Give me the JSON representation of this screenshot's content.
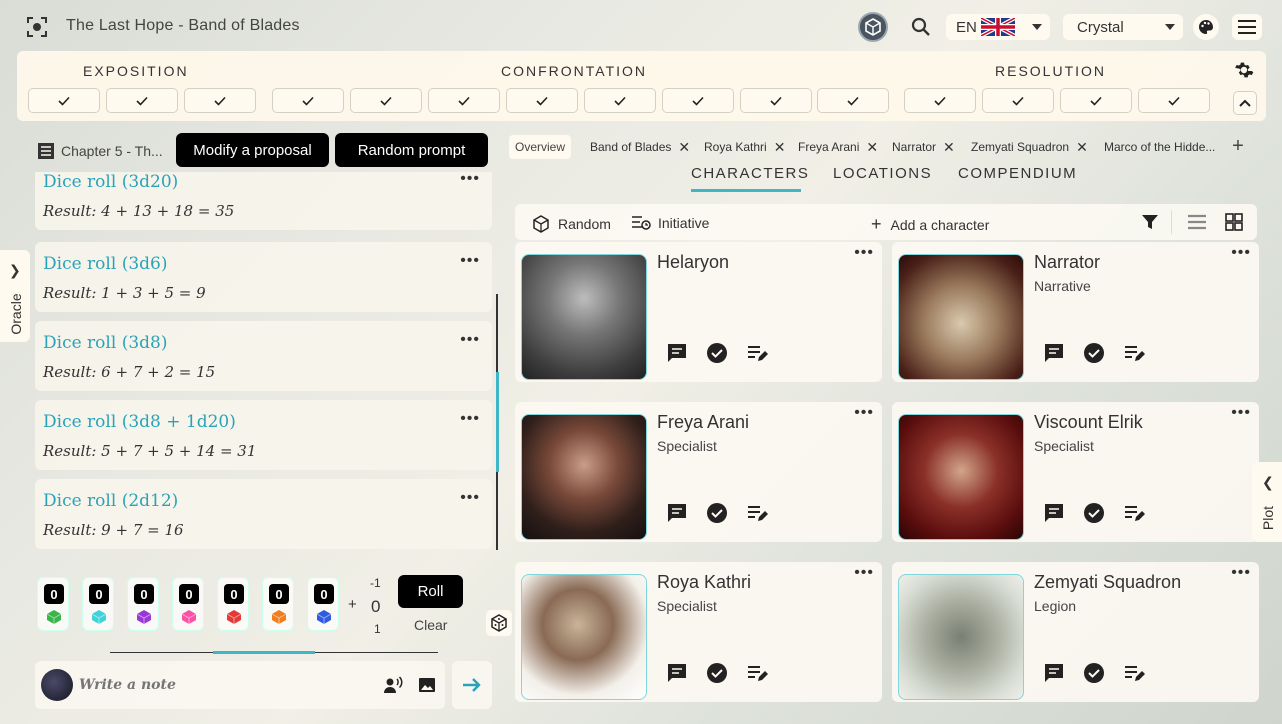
{
  "app": {
    "title": "The Last Hope - Band of Blades",
    "language": "EN",
    "user": "Crystal"
  },
  "acts": {
    "labels": [
      "EXPOSITION",
      "CONFRONTATION",
      "RESOLUTION"
    ],
    "check_count": 15
  },
  "left": {
    "chapter": "Chapter 5 - Th...",
    "modify_btn": "Modify a proposal",
    "random_prompt_btn": "Random prompt",
    "oracle_tab": "Oracle",
    "log": [
      {
        "title": "Dice roll (3d20)",
        "result": "Result: 4 + 13 + 18 = 35"
      },
      {
        "title": "Dice roll (3d6)",
        "result": "Result: 1 + 3 + 5 = 9"
      },
      {
        "title": "Dice roll (3d8)",
        "result": "Result: 6 + 7 + 2 = 15"
      },
      {
        "title": "Dice roll (3d8 + 1d20)",
        "result": "Result: 5 + 7 + 5 + 14 = 31"
      },
      {
        "title": "Dice roll (2d12)",
        "result": "Result: 9 + 7 = 16"
      }
    ],
    "more": "•••",
    "dice": [
      {
        "count": "0",
        "color": "#39b54a"
      },
      {
        "count": "0",
        "color": "#3fd3d8"
      },
      {
        "count": "0",
        "color": "#9b36d6"
      },
      {
        "count": "0",
        "color": "#ff4fa3"
      },
      {
        "count": "0",
        "color": "#e53935"
      },
      {
        "count": "0",
        "color": "#f07d1e"
      },
      {
        "count": "0",
        "color": "#2f5be0"
      }
    ],
    "plus": "+",
    "mod_minus": "-1",
    "mod_value": "0",
    "mod_plus": "1",
    "roll_btn": "Roll",
    "clear_btn": "Clear",
    "note_placeholder": "Write a note"
  },
  "right": {
    "tabs": [
      "Overview",
      "Band of Blades",
      "Roya Kathri",
      "Freya Arani",
      "Narrator",
      "Zemyati Squadron",
      "Marco of the Hidde..."
    ],
    "close": "✕",
    "sections": [
      "CHARACTERS",
      "LOCATIONS",
      "COMPENDIUM"
    ],
    "toolbar": {
      "random": "Random",
      "initiative": "Initiative",
      "add": "Add a character"
    },
    "characters": [
      {
        "name": "Helaryon",
        "role": ""
      },
      {
        "name": "Narrator",
        "role": "Narrative"
      },
      {
        "name": "Freya Arani",
        "role": "Specialist"
      },
      {
        "name": "Viscount Elrik",
        "role": "Specialist"
      },
      {
        "name": "Roya Kathri",
        "role": "Specialist"
      },
      {
        "name": "Zemyati Squadron",
        "role": "Legion"
      }
    ],
    "plot_tab": "Plot"
  },
  "colors": {
    "accent": "#3fb6c6",
    "card": "#f7f4ec"
  }
}
